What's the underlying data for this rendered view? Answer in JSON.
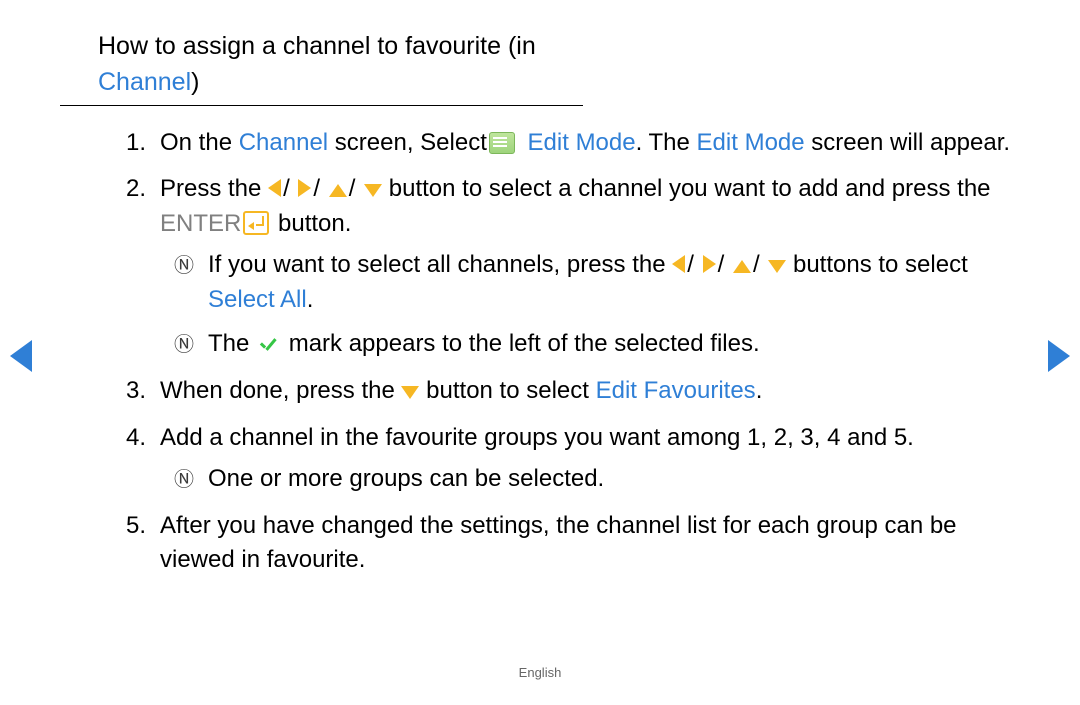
{
  "heading": {
    "prefix": "How to assign a channel to favourite (in ",
    "channel": "Channel",
    "suffix": ")"
  },
  "steps": {
    "s1": {
      "num": "1.",
      "a": "On the ",
      "channel": "Channel",
      "b": " screen, Select",
      "edit_mode": " Edit Mode",
      "c": ". The ",
      "edit_mode2": "Edit Mode",
      "d": " screen will appear."
    },
    "s2": {
      "num": "2.",
      "a": "Press the",
      "b": " button to select a channel you want to add and press the ",
      "enter": "ENTER",
      "c": " button."
    },
    "notes2": {
      "n1a": "If you want to select all channels, press the",
      "n1b": " buttons to select ",
      "n1link": "Select All",
      "n1c": ".",
      "n2a": "The ",
      "n2b": " mark appears to the left of the selected files."
    },
    "s3": {
      "num": "3.",
      "a": "When done, press the",
      "b": " button to select ",
      "edit_fav": "Edit Favourites",
      "c": "."
    },
    "s4": {
      "num": "4.",
      "a": "Add a channel in the favourite groups you want among 1, 2, 3, 4 and 5."
    },
    "notes4": {
      "n1": "One or more groups can be selected."
    },
    "s5": {
      "num": "5.",
      "a": "After you have changed the settings, the channel list for each group can be viewed in favourite."
    }
  },
  "footer": "English"
}
